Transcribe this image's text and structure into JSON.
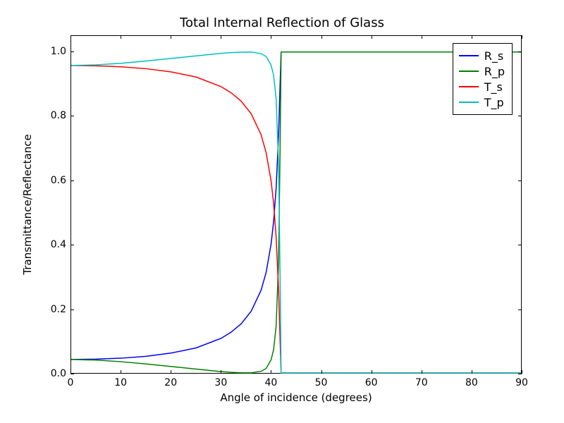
{
  "chart_data": {
    "type": "line",
    "title": "Total Internal Reflection of Glass",
    "xlabel": "Angle of incidence (degrees)",
    "ylabel": "Transmittance/Reflectance",
    "xlim": [
      0,
      90
    ],
    "ylim": [
      0.0,
      1.05
    ],
    "xticks": [
      0,
      10,
      20,
      30,
      40,
      50,
      60,
      70,
      80,
      90
    ],
    "yticks": [
      0.0,
      0.2,
      0.4,
      0.6,
      0.8,
      1.0
    ],
    "x": [
      0,
      5,
      10,
      15,
      20,
      25,
      30,
      32,
      34,
      36,
      38,
      39,
      40,
      40.5,
      41,
      41.5,
      41.8,
      42,
      42.5,
      43,
      45,
      50,
      60,
      70,
      80,
      90
    ],
    "series": [
      {
        "name": "R_s",
        "color": "#0000ff",
        "values": [
          0.042,
          0.043,
          0.046,
          0.052,
          0.062,
          0.078,
          0.108,
          0.127,
          0.153,
          0.192,
          0.258,
          0.313,
          0.402,
          0.472,
          0.575,
          0.742,
          0.9,
          1.0,
          1.0,
          1.0,
          1.0,
          1.0,
          1.0,
          1.0,
          1.0,
          1.0
        ]
      },
      {
        "name": "R_p",
        "color": "#008000",
        "values": [
          0.042,
          0.04,
          0.035,
          0.028,
          0.02,
          0.012,
          0.004,
          0.002,
          0.0006,
          0.0003,
          0.005,
          0.014,
          0.041,
          0.073,
          0.145,
          0.35,
          0.7,
          1.0,
          1.0,
          1.0,
          1.0,
          1.0,
          1.0,
          1.0,
          1.0,
          1.0
        ]
      },
      {
        "name": "T_s",
        "color": "#ff0000",
        "values": [
          0.958,
          0.957,
          0.954,
          0.948,
          0.938,
          0.922,
          0.892,
          0.873,
          0.847,
          0.808,
          0.742,
          0.687,
          0.598,
          0.528,
          0.425,
          0.258,
          0.1,
          0.0,
          0.0,
          0.0,
          0.0,
          0.0,
          0.0,
          0.0,
          0.0,
          0.0
        ]
      },
      {
        "name": "T_p",
        "color": "#00bfbf",
        "values": [
          0.958,
          0.96,
          0.965,
          0.972,
          0.98,
          0.988,
          0.996,
          0.998,
          0.9994,
          0.9997,
          0.995,
          0.986,
          0.959,
          0.927,
          0.855,
          0.65,
          0.3,
          0.0,
          0.0,
          0.0,
          0.0,
          0.0,
          0.0,
          0.0,
          0.0,
          0.0
        ]
      }
    ],
    "legend": {
      "position": "upper right",
      "entries": [
        "R_s",
        "R_p",
        "T_s",
        "T_p"
      ]
    }
  }
}
